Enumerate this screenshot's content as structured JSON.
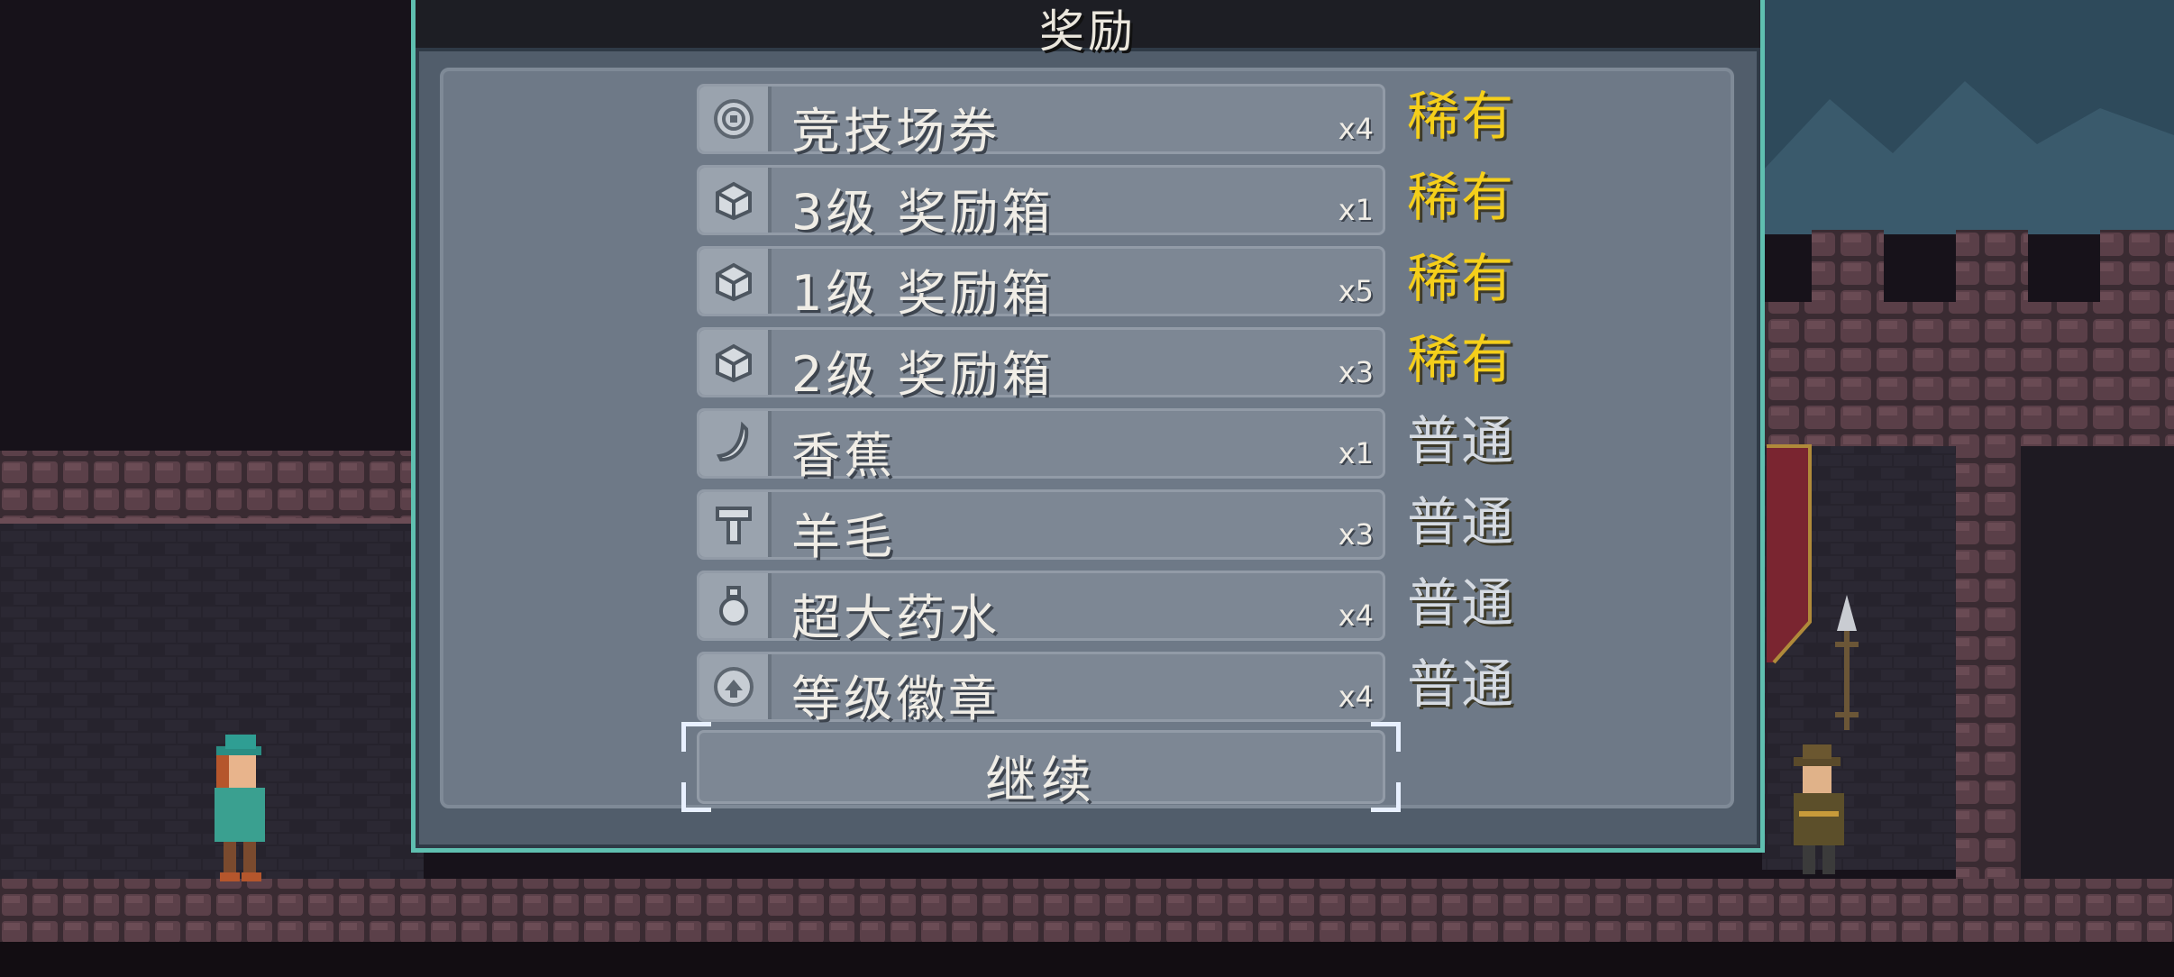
{
  "dialog": {
    "title": "奖励",
    "continue_label": "继续"
  },
  "rewards": [
    {
      "name": "竞技场券",
      "qty": "x4",
      "rarity": "稀有",
      "rarity_color": "#f5cf1a",
      "icon": "ticket-icon"
    },
    {
      "name": "3级 奖励箱",
      "qty": "x1",
      "rarity": "稀有",
      "rarity_color": "#f5cf1a",
      "icon": "chest-icon"
    },
    {
      "name": "1级 奖励箱",
      "qty": "x5",
      "rarity": "稀有",
      "rarity_color": "#f5cf1a",
      "icon": "chest-icon"
    },
    {
      "name": "2级 奖励箱",
      "qty": "x3",
      "rarity": "稀有",
      "rarity_color": "#f5cf1a",
      "icon": "chest-icon"
    },
    {
      "name": "香蕉",
      "qty": "x1",
      "rarity": "普通",
      "rarity_color": "#d6dbe2",
      "icon": "banana-icon"
    },
    {
      "name": "羊毛",
      "qty": "x3",
      "rarity": "普通",
      "rarity_color": "#d6dbe2",
      "icon": "wool-icon"
    },
    {
      "name": "超大药水",
      "qty": "x4",
      "rarity": "普通",
      "rarity_color": "#d6dbe2",
      "icon": "potion-icon"
    },
    {
      "name": "等级徽章",
      "qty": "x4",
      "rarity": "普通",
      "rarity_color": "#d6dbe2",
      "icon": "badge-icon"
    }
  ],
  "colors": {
    "panel_border": "#5fbfb0",
    "rare": "#f5cf1a",
    "common": "#d6dbe2"
  }
}
